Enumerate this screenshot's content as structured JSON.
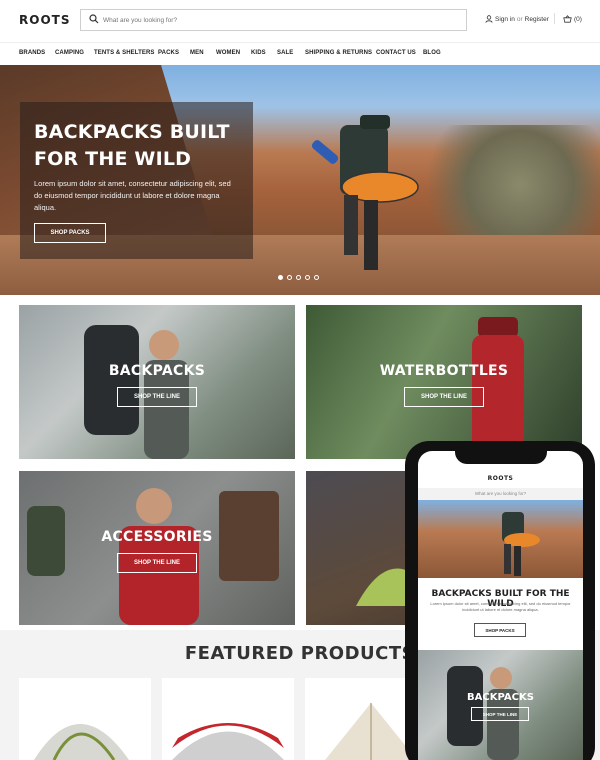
{
  "header": {
    "logo": "ROOTS",
    "search_placeholder": "What are you looking for?",
    "sign_in": "Sign in",
    "or": "or",
    "register": "Register",
    "cart": "(0)"
  },
  "nav": [
    "BRANDS",
    "CAMPING",
    "TENTS & SHELTERS",
    "PACKS",
    "MEN",
    "WOMEN",
    "KIDS",
    "SALE",
    "SHIPPING & RETURNS",
    "CONTACT US",
    "BLOG"
  ],
  "hero": {
    "title": "BACKPACKS BUILT FOR THE WILD",
    "text": "Lorem ipsum dolor sit amet, consectetur adipiscing elit, sed do eiusmod tempor incididunt ut labore et dolore magna aliqua.",
    "button": "SHOP PACKS",
    "slide_count": 5,
    "active_slide": 1
  },
  "tiles": [
    {
      "label": "BACKPACKS",
      "button": "SHOP THE LINE"
    },
    {
      "label": "WATERBOTTLES",
      "button": "SHOP THE LINE"
    },
    {
      "label": "ACCESSORIES",
      "button": "SHOP THE LINE"
    }
  ],
  "featured": {
    "title": "FEATURED PRODUCTS"
  },
  "mobile": {
    "logo": "ROOTS",
    "search_placeholder": "What are you looking for?",
    "hero_title": "BACKPACKS BUILT FOR THE WILD",
    "hero_text": "Lorem ipsum dolor sit amet, consectetur adipiscing elit, sed do eiusmod tempor incididunt ut labore et dolore magna aliqua.",
    "hero_button": "SHOP PACKS",
    "tile_label": "BACKPACKS",
    "tile_button": "SHOP THE LINE"
  }
}
